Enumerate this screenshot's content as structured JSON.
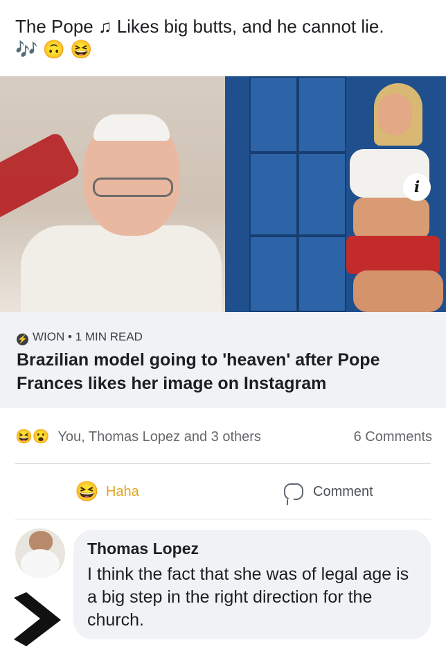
{
  "post": {
    "text": "The Pope ♫ Likes big butts, and he cannot lie.",
    "emoji_line": [
      "🎶",
      "🙃",
      "😆"
    ]
  },
  "link_card": {
    "info_badge": "i",
    "source": "WION • 1 MIN READ",
    "headline": "Brazilian model going to 'heaven' after Pope Frances likes her image on Instagram"
  },
  "reactions": {
    "icons": [
      "😆",
      "😮"
    ],
    "names": "You, Thomas Lopez and 3 others",
    "comments_count": "6 Comments"
  },
  "actions": {
    "haha_label": "Haha",
    "comment_label": "Comment"
  },
  "comment": {
    "author": "Thomas Lopez",
    "text": "I think the fact that she was of legal age is a big step in the right direction for the church."
  },
  "colors": {
    "haha": "#e0a419",
    "footer_bg": "#f0f2f5",
    "muted_text": "#65676b"
  }
}
